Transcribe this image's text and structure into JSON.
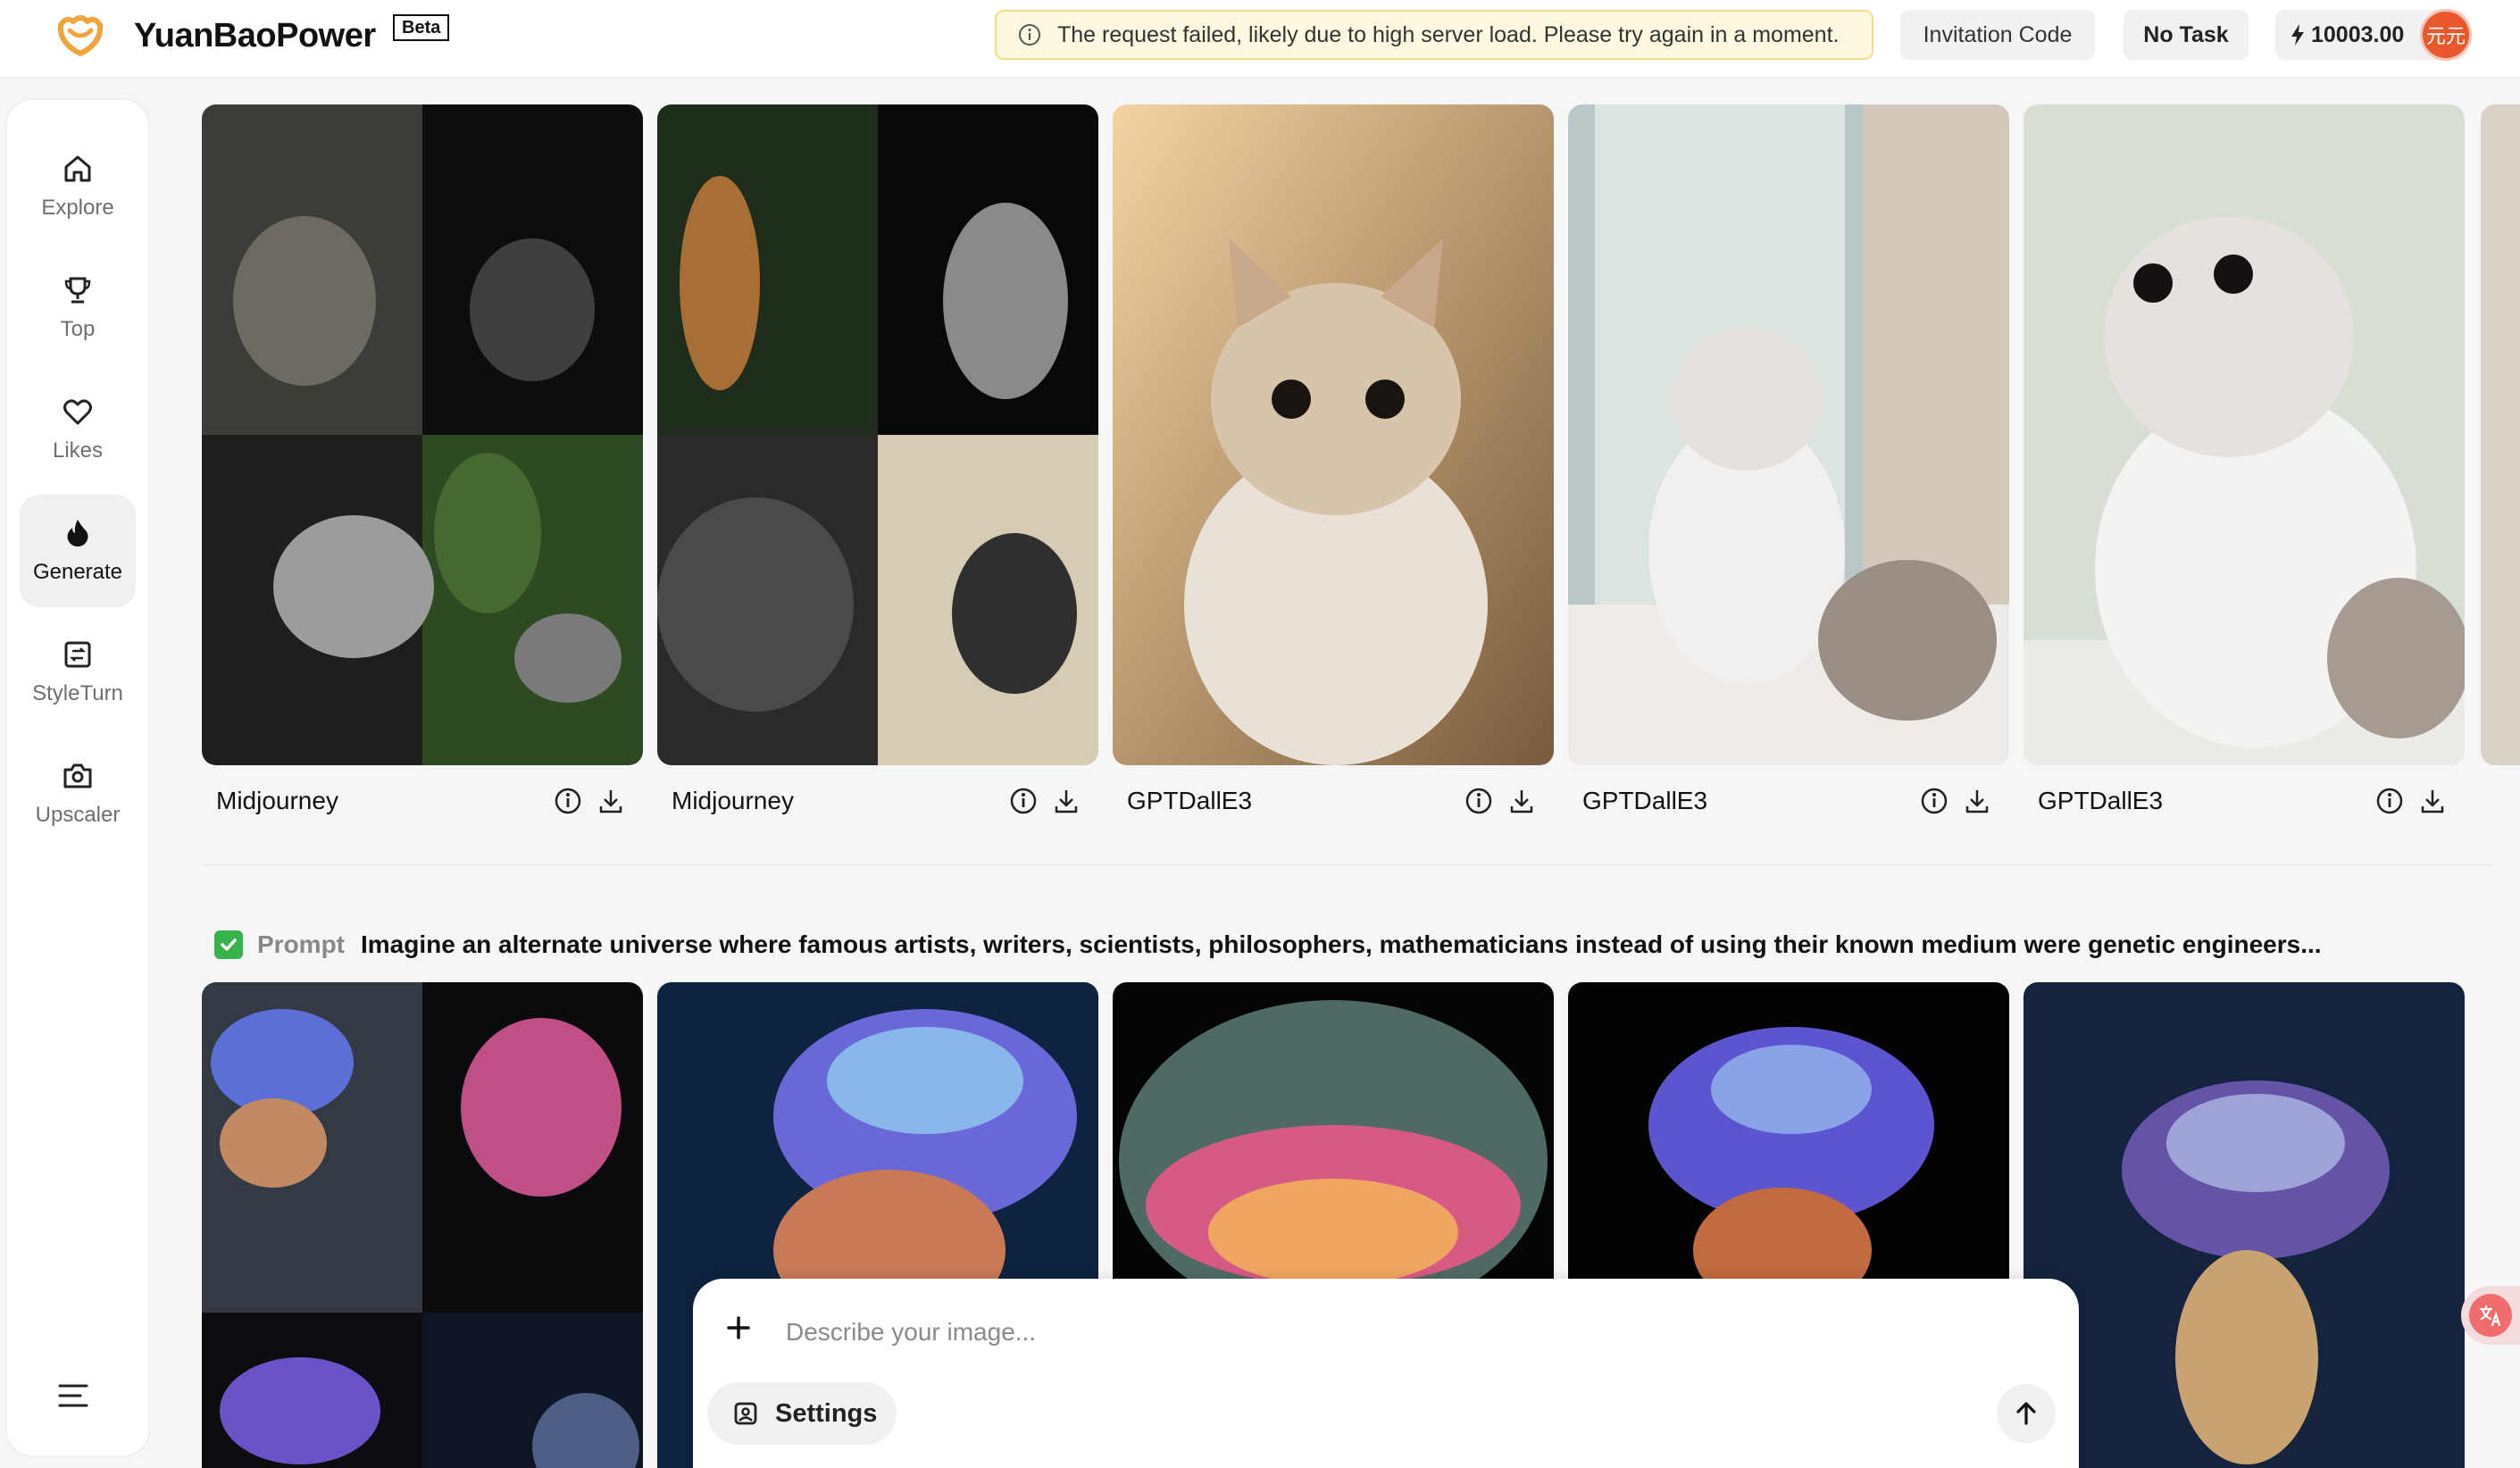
{
  "header": {
    "brand": "YuanBaoPower",
    "beta": "Beta",
    "alert": "The request failed, likely due to high server load. Please try again in a moment.",
    "invitation_label": "Invitation Code",
    "task_label": "No Task",
    "credits": "10003.00",
    "avatar_text": "元元"
  },
  "sidebar": {
    "items": [
      {
        "label": "Explore",
        "icon": "home-icon"
      },
      {
        "label": "Top",
        "icon": "trophy-icon"
      },
      {
        "label": "Likes",
        "icon": "heart-icon"
      },
      {
        "label": "Generate",
        "icon": "flame-icon",
        "active": true
      },
      {
        "label": "StyleTurn",
        "icon": "style-icon"
      },
      {
        "label": "Upscaler",
        "icon": "camera-icon"
      }
    ]
  },
  "results": {
    "row1": [
      {
        "model": "Midjourney"
      },
      {
        "model": "Midjourney"
      },
      {
        "model": "GPTDallE3"
      },
      {
        "model": "GPTDallE3"
      },
      {
        "model": "GPTDallE3"
      }
    ]
  },
  "prompt": {
    "label": "Prompt",
    "text": "Imagine an alternate universe where famous artists, writers, scientists, philosophers, mathematicians instead of using their known medium were genetic engineers..."
  },
  "composer": {
    "placeholder": "Describe your image...",
    "settings_label": "Settings"
  },
  "colors": {
    "accent": "#e9582d",
    "alert_bg": "#fdf8e0",
    "check_green": "#38b34a"
  }
}
